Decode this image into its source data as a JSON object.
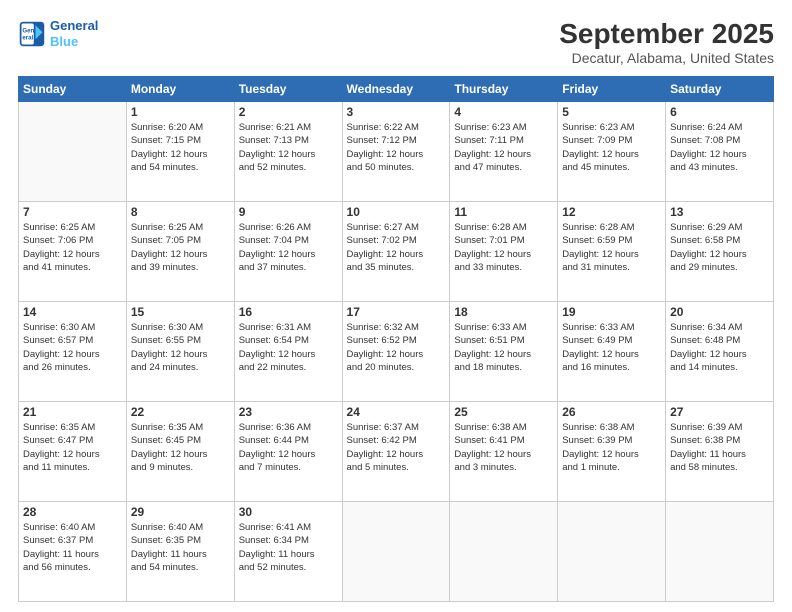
{
  "header": {
    "logo_line1": "General",
    "logo_line2": "Blue",
    "title": "September 2025",
    "subtitle": "Decatur, Alabama, United States"
  },
  "days_of_week": [
    "Sunday",
    "Monday",
    "Tuesday",
    "Wednesday",
    "Thursday",
    "Friday",
    "Saturday"
  ],
  "weeks": [
    [
      {
        "day": "",
        "info": ""
      },
      {
        "day": "1",
        "info": "Sunrise: 6:20 AM\nSunset: 7:15 PM\nDaylight: 12 hours\nand 54 minutes."
      },
      {
        "day": "2",
        "info": "Sunrise: 6:21 AM\nSunset: 7:13 PM\nDaylight: 12 hours\nand 52 minutes."
      },
      {
        "day": "3",
        "info": "Sunrise: 6:22 AM\nSunset: 7:12 PM\nDaylight: 12 hours\nand 50 minutes."
      },
      {
        "day": "4",
        "info": "Sunrise: 6:23 AM\nSunset: 7:11 PM\nDaylight: 12 hours\nand 47 minutes."
      },
      {
        "day": "5",
        "info": "Sunrise: 6:23 AM\nSunset: 7:09 PM\nDaylight: 12 hours\nand 45 minutes."
      },
      {
        "day": "6",
        "info": "Sunrise: 6:24 AM\nSunset: 7:08 PM\nDaylight: 12 hours\nand 43 minutes."
      }
    ],
    [
      {
        "day": "7",
        "info": "Sunrise: 6:25 AM\nSunset: 7:06 PM\nDaylight: 12 hours\nand 41 minutes."
      },
      {
        "day": "8",
        "info": "Sunrise: 6:25 AM\nSunset: 7:05 PM\nDaylight: 12 hours\nand 39 minutes."
      },
      {
        "day": "9",
        "info": "Sunrise: 6:26 AM\nSunset: 7:04 PM\nDaylight: 12 hours\nand 37 minutes."
      },
      {
        "day": "10",
        "info": "Sunrise: 6:27 AM\nSunset: 7:02 PM\nDaylight: 12 hours\nand 35 minutes."
      },
      {
        "day": "11",
        "info": "Sunrise: 6:28 AM\nSunset: 7:01 PM\nDaylight: 12 hours\nand 33 minutes."
      },
      {
        "day": "12",
        "info": "Sunrise: 6:28 AM\nSunset: 6:59 PM\nDaylight: 12 hours\nand 31 minutes."
      },
      {
        "day": "13",
        "info": "Sunrise: 6:29 AM\nSunset: 6:58 PM\nDaylight: 12 hours\nand 29 minutes."
      }
    ],
    [
      {
        "day": "14",
        "info": "Sunrise: 6:30 AM\nSunset: 6:57 PM\nDaylight: 12 hours\nand 26 minutes."
      },
      {
        "day": "15",
        "info": "Sunrise: 6:30 AM\nSunset: 6:55 PM\nDaylight: 12 hours\nand 24 minutes."
      },
      {
        "day": "16",
        "info": "Sunrise: 6:31 AM\nSunset: 6:54 PM\nDaylight: 12 hours\nand 22 minutes."
      },
      {
        "day": "17",
        "info": "Sunrise: 6:32 AM\nSunset: 6:52 PM\nDaylight: 12 hours\nand 20 minutes."
      },
      {
        "day": "18",
        "info": "Sunrise: 6:33 AM\nSunset: 6:51 PM\nDaylight: 12 hours\nand 18 minutes."
      },
      {
        "day": "19",
        "info": "Sunrise: 6:33 AM\nSunset: 6:49 PM\nDaylight: 12 hours\nand 16 minutes."
      },
      {
        "day": "20",
        "info": "Sunrise: 6:34 AM\nSunset: 6:48 PM\nDaylight: 12 hours\nand 14 minutes."
      }
    ],
    [
      {
        "day": "21",
        "info": "Sunrise: 6:35 AM\nSunset: 6:47 PM\nDaylight: 12 hours\nand 11 minutes."
      },
      {
        "day": "22",
        "info": "Sunrise: 6:35 AM\nSunset: 6:45 PM\nDaylight: 12 hours\nand 9 minutes."
      },
      {
        "day": "23",
        "info": "Sunrise: 6:36 AM\nSunset: 6:44 PM\nDaylight: 12 hours\nand 7 minutes."
      },
      {
        "day": "24",
        "info": "Sunrise: 6:37 AM\nSunset: 6:42 PM\nDaylight: 12 hours\nand 5 minutes."
      },
      {
        "day": "25",
        "info": "Sunrise: 6:38 AM\nSunset: 6:41 PM\nDaylight: 12 hours\nand 3 minutes."
      },
      {
        "day": "26",
        "info": "Sunrise: 6:38 AM\nSunset: 6:39 PM\nDaylight: 12 hours\nand 1 minute."
      },
      {
        "day": "27",
        "info": "Sunrise: 6:39 AM\nSunset: 6:38 PM\nDaylight: 11 hours\nand 58 minutes."
      }
    ],
    [
      {
        "day": "28",
        "info": "Sunrise: 6:40 AM\nSunset: 6:37 PM\nDaylight: 11 hours\nand 56 minutes."
      },
      {
        "day": "29",
        "info": "Sunrise: 6:40 AM\nSunset: 6:35 PM\nDaylight: 11 hours\nand 54 minutes."
      },
      {
        "day": "30",
        "info": "Sunrise: 6:41 AM\nSunset: 6:34 PM\nDaylight: 11 hours\nand 52 minutes."
      },
      {
        "day": "",
        "info": ""
      },
      {
        "day": "",
        "info": ""
      },
      {
        "day": "",
        "info": ""
      },
      {
        "day": "",
        "info": ""
      }
    ]
  ]
}
